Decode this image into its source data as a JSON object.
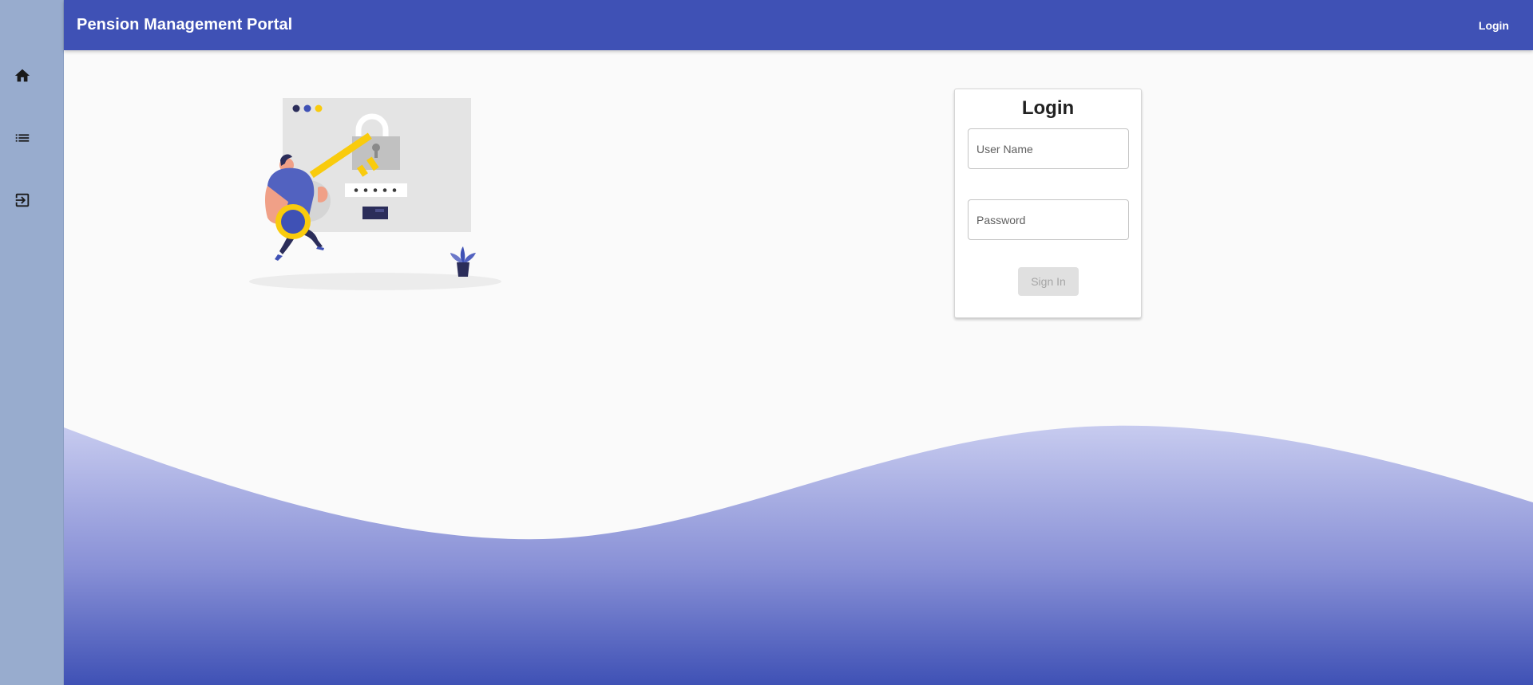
{
  "app": {
    "title": "Pension Management Portal"
  },
  "topbar": {
    "login_label": "Login"
  },
  "sidebar": {
    "items": [
      {
        "icon": "home-icon"
      },
      {
        "icon": "list-icon"
      },
      {
        "icon": "exit-icon"
      }
    ]
  },
  "login_card": {
    "title": "Login",
    "username_placeholder": "User Name",
    "username_value": "",
    "password_placeholder": "Password",
    "password_value": "",
    "signin_label": "Sign In"
  },
  "colors": {
    "primary": "#3f51b5",
    "sidebar": "#98acce",
    "accent_yellow": "#f9cb0d",
    "wave_light": "#bec4eb"
  }
}
